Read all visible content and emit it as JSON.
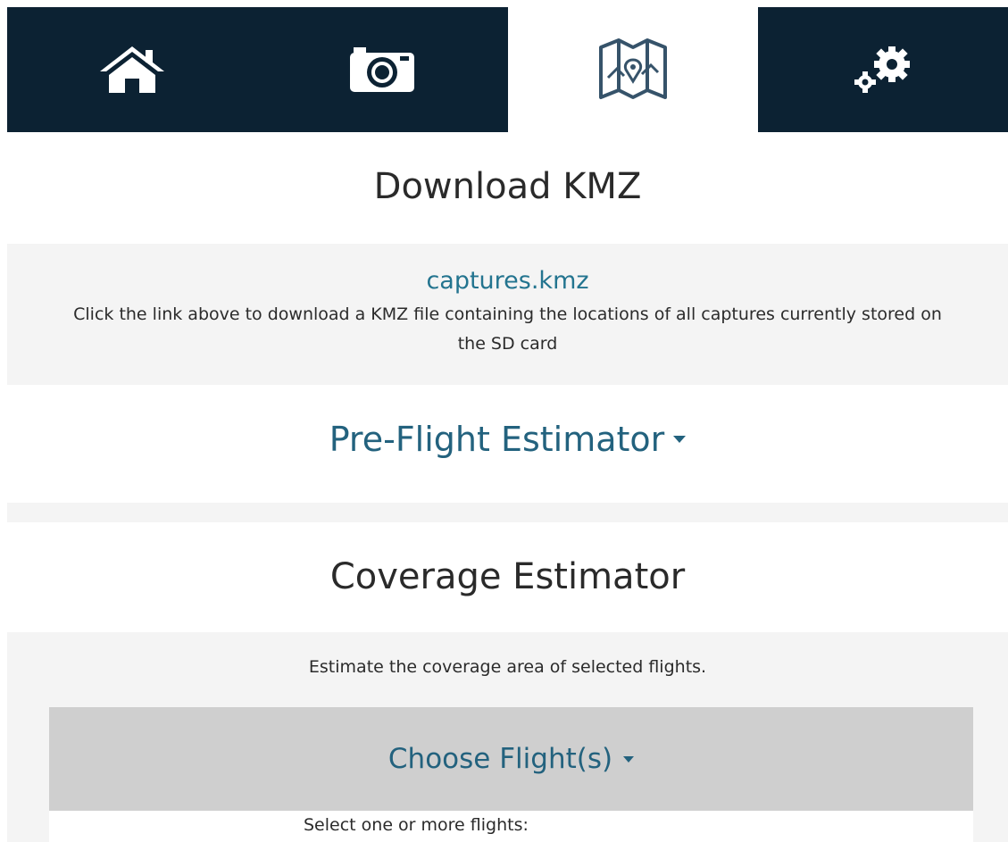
{
  "nav": {
    "tabs": [
      {
        "icon": "home-icon",
        "active": false
      },
      {
        "icon": "camera-icon",
        "active": false
      },
      {
        "icon": "map-icon",
        "active": true
      },
      {
        "icon": "gears-icon",
        "active": false
      }
    ]
  },
  "kmz": {
    "title": "Download KMZ",
    "link_text": "captures.kmz",
    "description": "Click the link above to download a KMZ file containing the locations of all captures currently stored on the SD card"
  },
  "preflight": {
    "label": "Pre-Flight Estimator"
  },
  "coverage": {
    "title": "Coverage Estimator",
    "description": "Estimate the coverage area of selected flights.",
    "choose_label": "Choose Flight(s)",
    "select_label": "Select one or more flights:"
  },
  "colors": {
    "nav_bg": "#0c2233",
    "accent": "#23627e",
    "link": "#23748f",
    "panel_bg": "#f4f4f4",
    "button_bg": "#cfcfcf"
  }
}
